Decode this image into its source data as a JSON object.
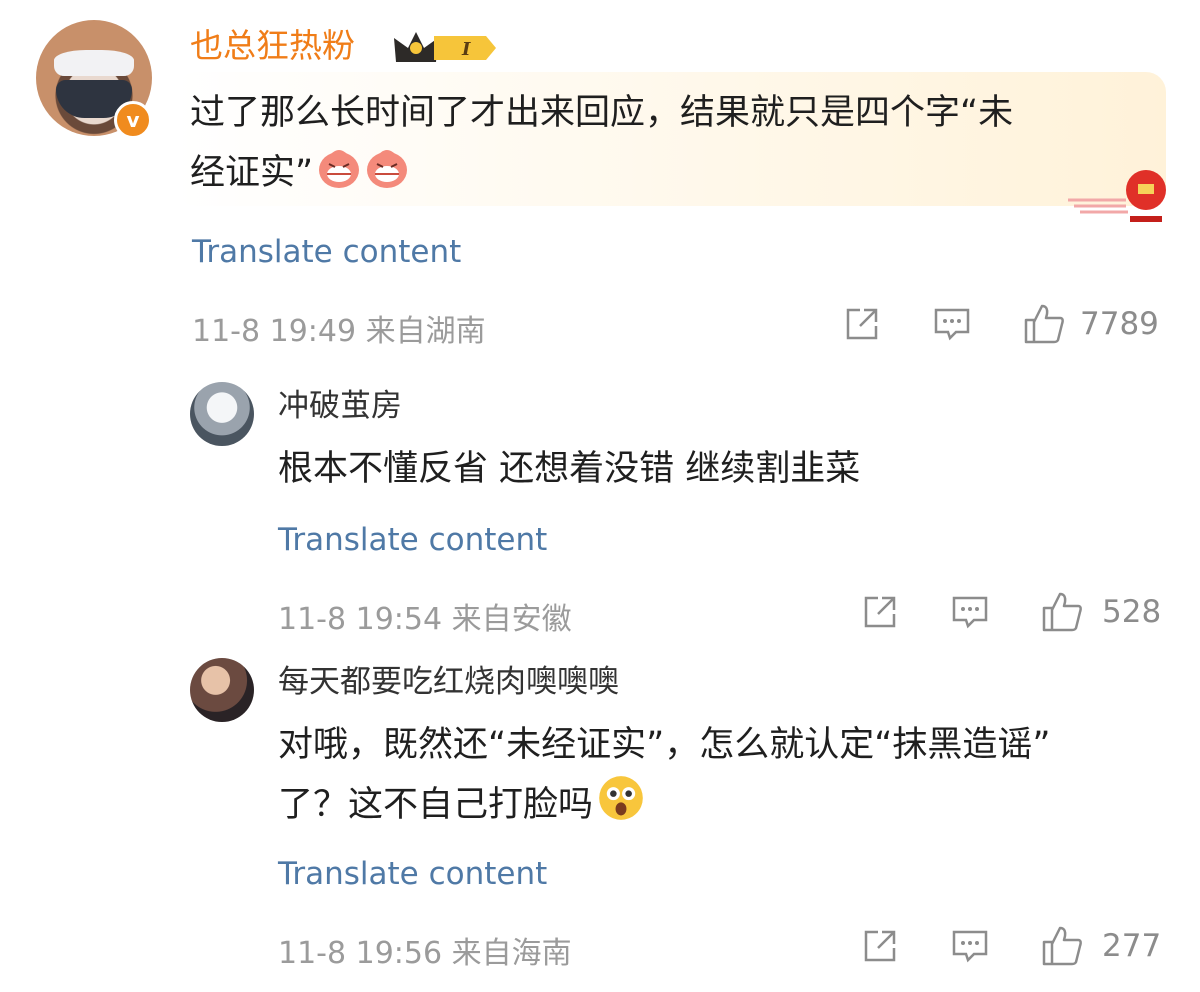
{
  "comments": [
    {
      "username": "也总狂热粉",
      "text_line1": "过了那么长时间了才出来回应，结果就只是四个字“未",
      "text_line2": "经证实”",
      "translate": "Translate content",
      "meta": "11-8 19:49  来自湖南",
      "likes": "7789",
      "badge": "I",
      "verified_icon": "v"
    }
  ],
  "replies": [
    {
      "username": "冲破茧房",
      "text_line1": "根本不懂反省  还想着没错  继续割韭菜",
      "translate": "Translate content",
      "meta": "11-8 19:54  来自安徽",
      "likes": "528"
    },
    {
      "username": "每天都要吃红烧肉噢噢噢",
      "text_line1": "对哦，既然还“未经证实”，怎么就认定“抹黑造谣”",
      "text_line2": "了？这不自己打脸吗",
      "translate": "Translate content",
      "meta": "11-8 19:56  来自海南",
      "likes": "277"
    }
  ],
  "icons": {
    "share": "share-icon",
    "comment": "comment-icon",
    "like": "thumbs-up-icon"
  },
  "colors": {
    "username_accent": "#f07d18",
    "link": "#4f79a6",
    "meta": "#9b9b9b"
  }
}
